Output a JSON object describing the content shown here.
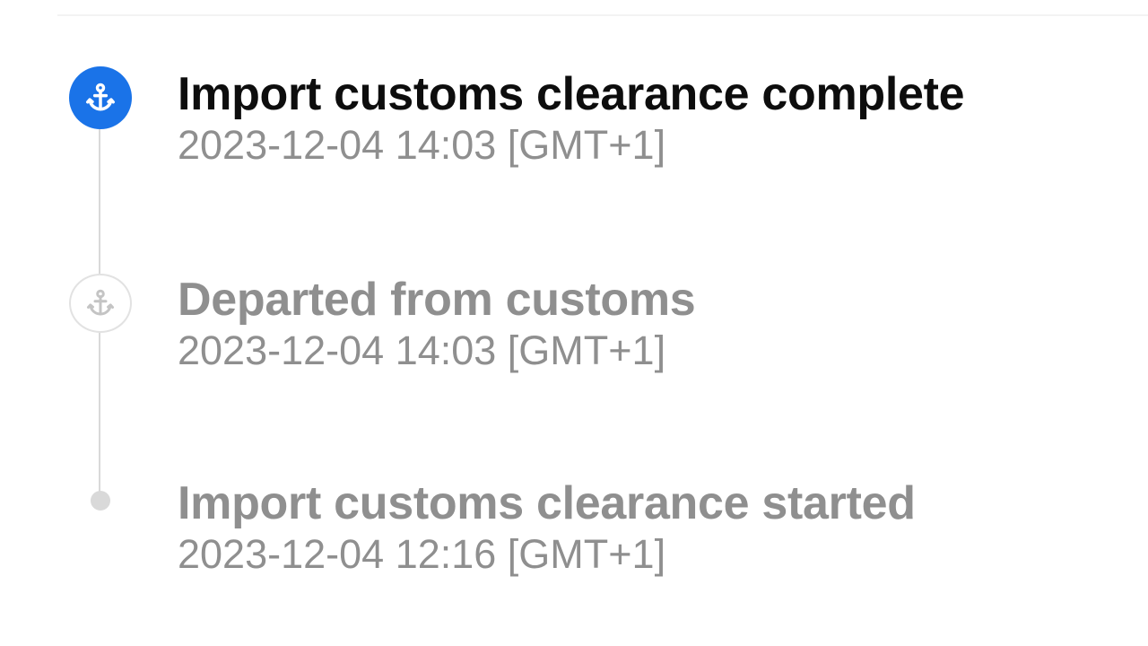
{
  "colors": {
    "accent": "#1a73e8",
    "title_current": "#0d0d0d",
    "muted": "#8f8f8f",
    "track": "#d9d9d9"
  },
  "timeline": {
    "events": [
      {
        "title": "Import customs clearance complete",
        "timestamp": "2023-12-04 14:03 [GMT+1]",
        "icon": "anchor-icon",
        "state": "current"
      },
      {
        "title": "Departed from customs",
        "timestamp": "2023-12-04 14:03 [GMT+1]",
        "icon": "anchor-icon",
        "state": "past"
      },
      {
        "title": "Import customs clearance started",
        "timestamp": "2023-12-04 12:16 [GMT+1]",
        "icon": "dot-icon",
        "state": "past"
      }
    ]
  }
}
